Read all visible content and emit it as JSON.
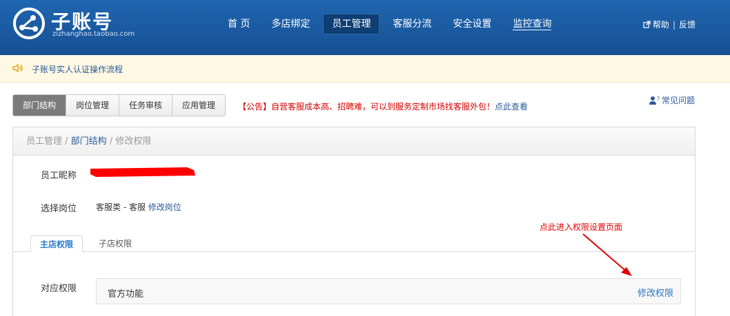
{
  "header": {
    "logo_title": "子账号",
    "logo_sub": "zizhanghao.taobao.com",
    "nav": [
      {
        "label": "首 页",
        "active": false
      },
      {
        "label": "多店绑定",
        "active": false
      },
      {
        "label": "员工管理",
        "active": true
      },
      {
        "label": "客服分流",
        "active": false
      },
      {
        "label": "安全设置",
        "active": false
      },
      {
        "label": "监控查询",
        "active": false
      }
    ],
    "help": "帮助",
    "separator": "|",
    "feedback": "反馈"
  },
  "notice": {
    "text": "子账号实人认证操作流程"
  },
  "tabs": [
    {
      "label": "部门结构",
      "active": true
    },
    {
      "label": "岗位管理",
      "active": false
    },
    {
      "label": "任务审核",
      "active": false
    },
    {
      "label": "应用管理",
      "active": false
    }
  ],
  "announcement": {
    "text": "【公告】自营客服成本高、招聘难，可以到服务定制市场找客服外包！",
    "link": "点此查看"
  },
  "faq": "常见问题",
  "breadcrumb": {
    "item1": "员工管理",
    "sep1": " / ",
    "item2": "部门结构",
    "sep2": " / ",
    "item3": "修改权限"
  },
  "form": {
    "nickname_label": "员工昵称",
    "position_label": "选择岗位",
    "position_value": "客服类 - 客服",
    "position_edit": "修改岗位",
    "permission_label": "对应权限"
  },
  "subtabs": {
    "main": "主店权限",
    "sub": "子店权限"
  },
  "permission": {
    "name": "官方功能",
    "edit": "修改权限"
  },
  "annotation": "点此进入权限设置页面",
  "colors": {
    "header_bg": "#1a5ba3",
    "link": "#2a5a98",
    "alert_red": "#d40000",
    "annotation_red": "#e00000"
  }
}
